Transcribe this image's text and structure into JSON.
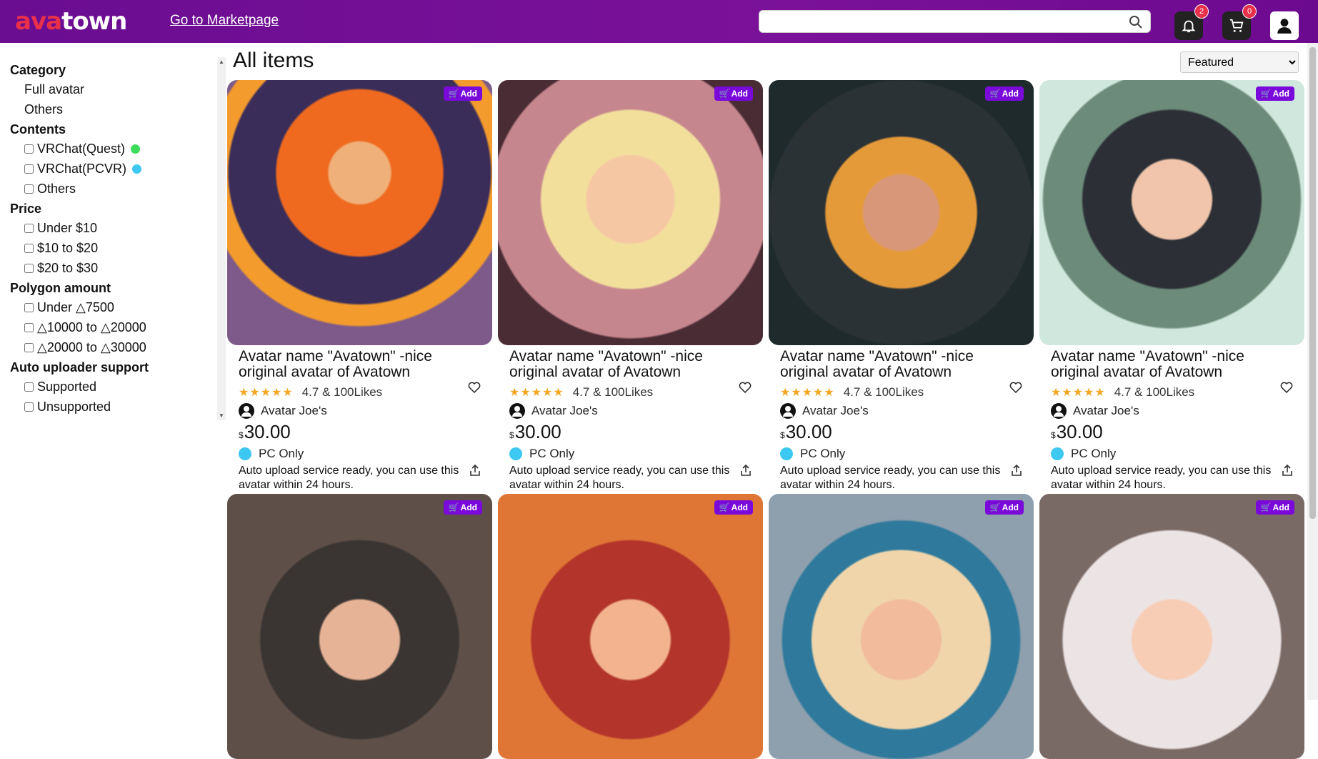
{
  "header": {
    "logo_a": "ava",
    "logo_b": "town",
    "market_link": "Go to Marketpage",
    "search_placeholder": "",
    "notifications_count": "2",
    "cart_count": "0"
  },
  "sidebar": {
    "category_heading": "Category",
    "category_items": [
      "Full avatar",
      "Others"
    ],
    "contents_heading": "Contents",
    "contents_items": [
      {
        "label": "VRChat(Quest)",
        "color": "#3ddc5a"
      },
      {
        "label": "VRChat(PCVR)",
        "color": "#3cc8f0"
      },
      {
        "label": "Others"
      }
    ],
    "price_heading": "Price",
    "price_items": [
      "Under $10",
      "$10 to $20",
      "$20 to $30"
    ],
    "polygon_heading": "Polygon amount",
    "polygon_items": [
      "Under △7500",
      "△10000 to △20000",
      "△20000 to △30000"
    ],
    "uploader_heading": "Auto uploader support",
    "uploader_items": [
      "Supported",
      "Unsupported"
    ]
  },
  "main": {
    "title": "All items",
    "sort_selected": "Featured"
  },
  "card_common": {
    "add_label": "Add",
    "title": "Avatar name \"Avatown\" -nice original avatar of Avatown",
    "rating_text": "4.7 & 100Likes",
    "seller": "Avatar Joe's",
    "currency": "$",
    "price": "30.00",
    "platform": "PC Only",
    "note": "Auto upload service ready, you can use this avatar within 24 hours."
  },
  "colors": {
    "header": "#6a0d91",
    "add_button": "#7a0ad9",
    "accent_red": "#e8304a",
    "star": "#f5a623",
    "pc_dot": "#3cc8f0"
  }
}
